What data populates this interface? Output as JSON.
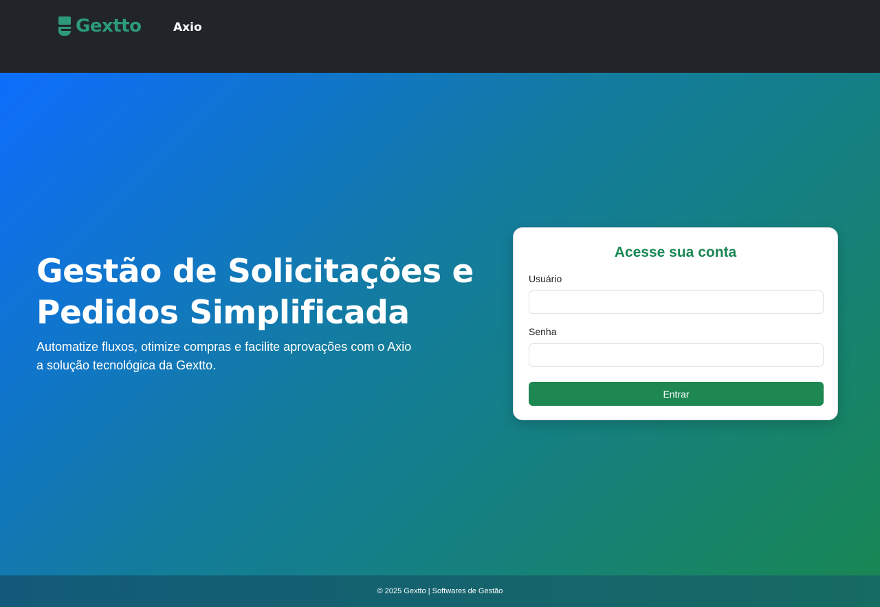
{
  "header": {
    "brand_name": "Gextto",
    "brand_icon": "gextto-logo-icon",
    "nav_link": "Axio",
    "brand_color": "#2d9b7b"
  },
  "hero": {
    "headline": "Gestão de Solicitações e Pedidos Simplificada",
    "lead_line1_pre": "Automatize fluxos, otimize compras e facilite aprovações com o ",
    "lead_line1_product": "Axio",
    "lead_line2_pre": "a solução tecnológica da ",
    "lead_line2_company": "Gextto",
    "lead_line2_post": "."
  },
  "login": {
    "title": "Acesse sua conta",
    "username_label": "Usuário",
    "username_value": "",
    "password_label": "Senha",
    "password_value": "",
    "submit_label": "Entrar",
    "accent_color": "#198754"
  },
  "footer": {
    "text": "© 2025 Gextto | Softwares de Gestão"
  }
}
